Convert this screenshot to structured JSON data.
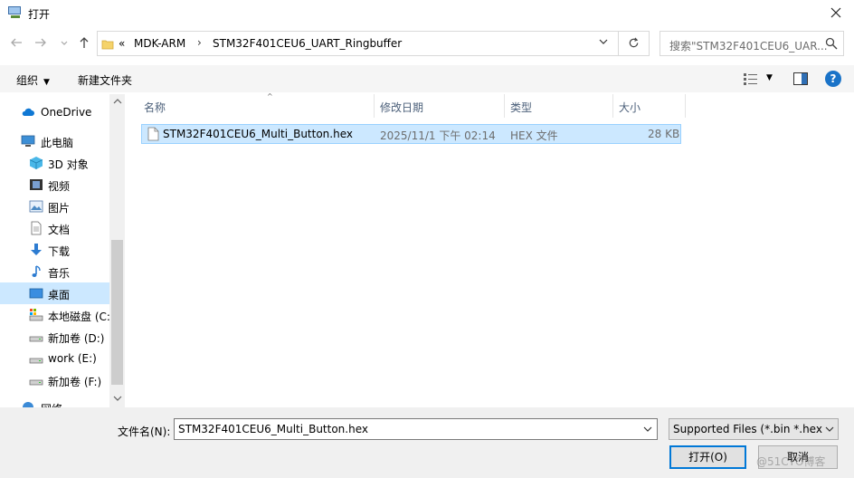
{
  "window": {
    "title": "打开"
  },
  "address": {
    "overflow": "«",
    "segments": [
      "MDK-ARM",
      "STM32F401CEU6_UART_Ringbuffer"
    ],
    "separator": "›"
  },
  "search": {
    "placeholder": "搜索\"STM32F401CEU6_UAR..."
  },
  "toolbar": {
    "organize": "组织",
    "new_folder": "新建文件夹",
    "help": "?"
  },
  "sidebar": {
    "items": [
      {
        "label": "OneDrive",
        "icon": "cloud-icon"
      },
      {
        "label": "此电脑",
        "icon": "computer-icon"
      },
      {
        "label": "3D 对象",
        "icon": "cube-icon"
      },
      {
        "label": "视频",
        "icon": "video-icon"
      },
      {
        "label": "图片",
        "icon": "picture-icon"
      },
      {
        "label": "文档",
        "icon": "document-icon"
      },
      {
        "label": "下载",
        "icon": "download-icon"
      },
      {
        "label": "音乐",
        "icon": "music-icon"
      },
      {
        "label": "桌面",
        "icon": "desktop-icon",
        "selected": true
      },
      {
        "label": "本地磁盘 (C:",
        "icon": "drive-icon"
      },
      {
        "label": "新加卷 (D:)",
        "icon": "drive-icon"
      },
      {
        "label": "work (E:)",
        "icon": "drive-icon"
      },
      {
        "label": "新加卷 (F:)",
        "icon": "drive-icon"
      },
      {
        "label": "网络",
        "icon": "network-icon"
      }
    ]
  },
  "columns": {
    "name": "名称",
    "date": "修改日期",
    "type": "类型",
    "size": "大小"
  },
  "files": [
    {
      "name": "STM32F401CEU6_Multi_Button.hex",
      "date": "2025/11/1 下午 02:14",
      "type": "HEX 文件",
      "size": "28 KB"
    }
  ],
  "bottom": {
    "filename_label": "文件名(N):",
    "filename_value": "STM32F401CEU6_Multi_Button.hex",
    "filetype_value": "Supported Files (*.bin *.hex *",
    "open_label": "打开(O)",
    "cancel_label": "取消"
  },
  "watermark": "@51CTO博客",
  "colors": {
    "accent": "#0078d7",
    "selection": "#cce8ff",
    "header_text": "#4c607a"
  }
}
